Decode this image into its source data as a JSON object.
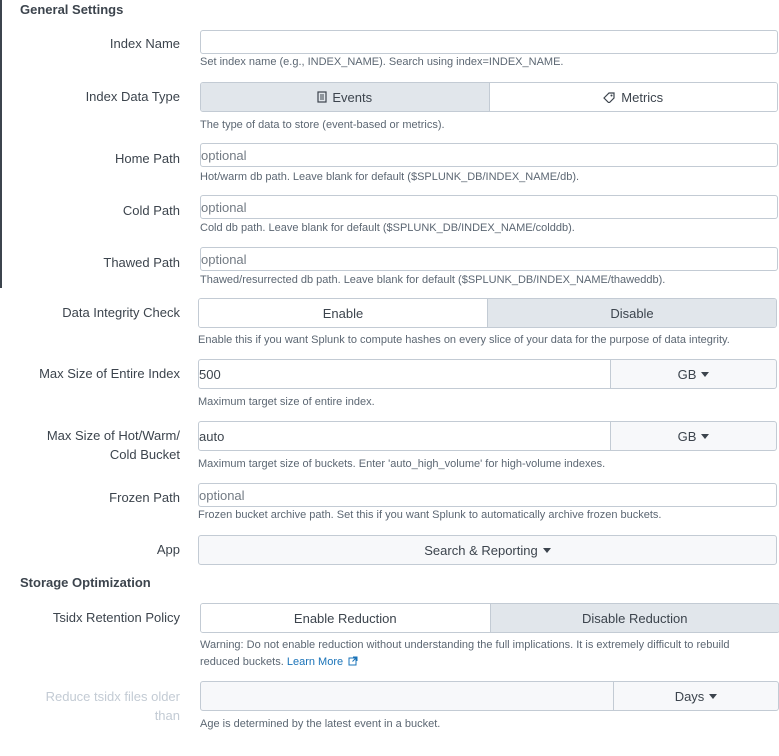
{
  "sections": {
    "general": "General Settings",
    "storage": "Storage Optimization"
  },
  "index_name": {
    "label": "Index Name",
    "value": "",
    "help": "Set index name (e.g., INDEX_NAME). Search using index=INDEX_NAME."
  },
  "index_data_type": {
    "label": "Index Data Type",
    "options": [
      "Events",
      "Metrics"
    ],
    "selected": "Events",
    "help": "The type of data to store (event-based or metrics)."
  },
  "home_path": {
    "label": "Home Path",
    "placeholder": "optional",
    "help": "Hot/warm db path. Leave blank for default ($SPLUNK_DB/INDEX_NAME/db)."
  },
  "cold_path": {
    "label": "Cold Path",
    "placeholder": "optional",
    "help": "Cold db path. Leave blank for default ($SPLUNK_DB/INDEX_NAME/colddb)."
  },
  "thawed_path": {
    "label": "Thawed Path",
    "placeholder": "optional",
    "help": "Thawed/resurrected db path. Leave blank for default ($SPLUNK_DB/INDEX_NAME/thaweddb)."
  },
  "integrity": {
    "label": "Data Integrity Check",
    "options": [
      "Enable",
      "Disable"
    ],
    "selected": "Disable",
    "help": "Enable this if you want Splunk to compute hashes on every slice of your data for the purpose of data integrity."
  },
  "max_index": {
    "label": "Max Size of Entire Index",
    "value": "500",
    "unit": "GB",
    "help": "Maximum target size of entire index."
  },
  "max_bucket": {
    "label_line1": "Max Size of Hot/Warm/",
    "label_line2": "Cold Bucket",
    "value": "auto",
    "unit": "GB",
    "help": "Maximum target size of buckets. Enter 'auto_high_volume' for high-volume indexes."
  },
  "frozen_path": {
    "label": "Frozen Path",
    "placeholder": "optional",
    "help": "Frozen bucket archive path. Set this if you want Splunk to automatically archive frozen buckets."
  },
  "app": {
    "label": "App",
    "value": "Search & Reporting"
  },
  "tsidx": {
    "label": "Tsidx Retention Policy",
    "options": [
      "Enable Reduction",
      "Disable Reduction"
    ],
    "selected": "Disable Reduction",
    "help_line1": "Warning: Do not enable reduction without understanding the full implications. It is extremely difficult to rebuild",
    "help_line2": "reduced buckets.",
    "learn_more": "Learn More"
  },
  "reduce_older": {
    "label_line1": "Reduce tsidx files older",
    "label_line2": "than",
    "value": "",
    "unit": "Days",
    "help": "Age is determined by the latest event in a bucket."
  },
  "icons": [
    "document-icon",
    "tag-icon",
    "external-link-icon",
    "caret-down-icon"
  ],
  "colors": {
    "active_segment": "#e1e6eb",
    "link": "#1a73b8",
    "border": "#c3cbd4"
  }
}
